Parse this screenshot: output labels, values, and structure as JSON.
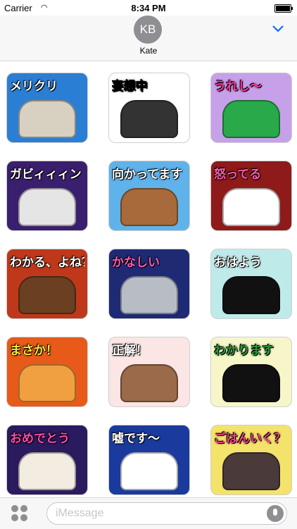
{
  "status": {
    "carrier": "Carrier",
    "time": "8:34 PM"
  },
  "header": {
    "initials": "KB",
    "name": "Kate"
  },
  "stickers": [
    {
      "label": "メリクリ",
      "bg": "#2a7fd4",
      "fg": "#ffffff",
      "animal": "#d8d0c0"
    },
    {
      "label": "妄想中",
      "bg": "#ffffff",
      "fg": "#000000",
      "animal": "#333333"
    },
    {
      "label": "うれし～",
      "bg": "#c7a0ea",
      "fg": "#ff3aa0",
      "animal": "#2aa94a"
    },
    {
      "label": "ガビィィィン",
      "bg": "#3a1f6e",
      "fg": "#ffffff",
      "animal": "#e5e5e5"
    },
    {
      "label": "向かってます",
      "bg": "#5fb3ea",
      "fg": "#ffffff",
      "animal": "#a86a3a"
    },
    {
      "label": "怒ってる",
      "bg": "#8e1a1a",
      "fg": "#ff5ab0",
      "animal": "#ffffff"
    },
    {
      "label": "わかる、よね？",
      "bg": "#c0381a",
      "fg": "#ffffff",
      "animal": "#6b3f21"
    },
    {
      "label": "かなしい",
      "bg": "#1e2a74",
      "fg": "#ff5ab0",
      "animal": "#b8bcc5"
    },
    {
      "label": "おはよう",
      "bg": "#bfeaea",
      "fg": "#ffffff",
      "animal": "#111111"
    },
    {
      "label": "まさか！",
      "bg": "#e85a1a",
      "fg": "#ffea3a",
      "animal": "#f0a040"
    },
    {
      "label": "正解！",
      "bg": "#fbe5e5",
      "fg": "#ffffff",
      "animal": "#9a6a4a"
    },
    {
      "label": "わかります",
      "bg": "#f6f6c8",
      "fg": "#2a9a3a",
      "animal": "#111111"
    },
    {
      "label": "おめでとう",
      "bg": "#2a1a5e",
      "fg": "#ff4ab0",
      "animal": "#f3ece0"
    },
    {
      "label": "嘘です～",
      "bg": "#1a3a9e",
      "fg": "#ffffff",
      "animal": "#ffffff"
    },
    {
      "label": "ごはんいく？",
      "bg": "#f4e36a",
      "fg": "#ff3a8a",
      "animal": "#4a3a3a"
    }
  ],
  "input": {
    "placeholder": "iMessage"
  }
}
